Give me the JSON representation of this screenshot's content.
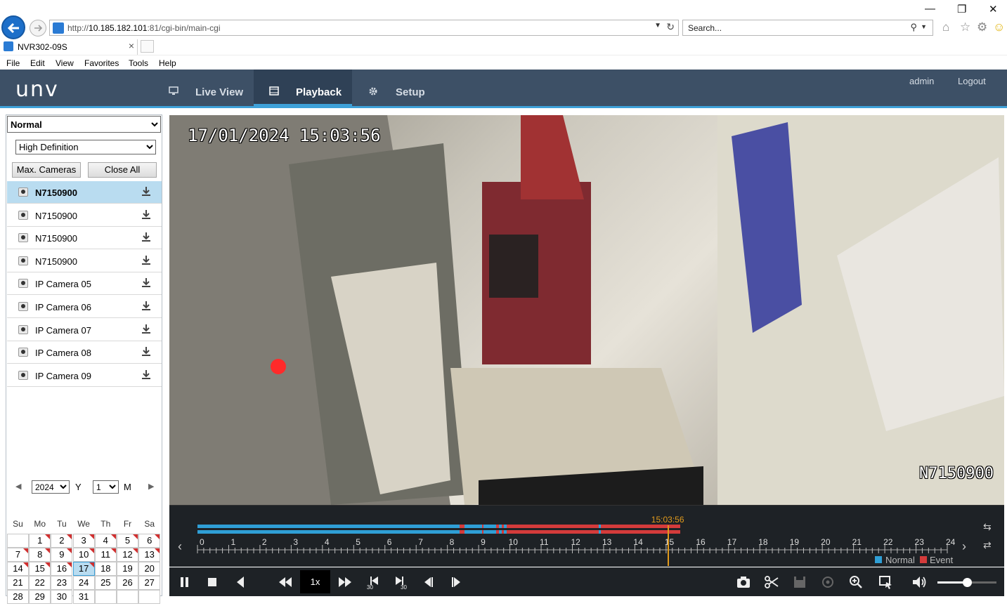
{
  "browser": {
    "url_prefix": "http://",
    "url_host": "10.185.182.101",
    "url_rest": ":81/cgi-bin/main-cgi",
    "search_placeholder": "Search...",
    "tab_title": "NVR302-09S",
    "menu": [
      "File",
      "Edit",
      "View",
      "Favorites",
      "Tools",
      "Help"
    ]
  },
  "app": {
    "logo": "unv",
    "nav": [
      {
        "label": "Live View",
        "icon": "monitor-icon",
        "active": false
      },
      {
        "label": "Playback",
        "icon": "film-icon",
        "active": true
      },
      {
        "label": "Setup",
        "icon": "gear-icon",
        "active": false
      }
    ],
    "user": "admin",
    "logout": "Logout"
  },
  "left": {
    "mode": "Normal",
    "quality": "High Definition",
    "max_cameras": "Max. Cameras",
    "close_all": "Close All",
    "cameras": [
      {
        "name": "N7150900",
        "selected": true
      },
      {
        "name": "N7150900",
        "selected": false
      },
      {
        "name": "N7150900",
        "selected": false
      },
      {
        "name": "N7150900",
        "selected": false
      },
      {
        "name": "IP Camera 05",
        "selected": false
      },
      {
        "name": "IP Camera 06",
        "selected": false
      },
      {
        "name": "IP Camera 07",
        "selected": false
      },
      {
        "name": "IP Camera 08",
        "selected": false
      },
      {
        "name": "IP Camera 09",
        "selected": false
      }
    ]
  },
  "calendar": {
    "year": "2024",
    "year_label": "Y",
    "month": "1",
    "month_label": "M",
    "weekdays": [
      "Su",
      "Mo",
      "Tu",
      "We",
      "Th",
      "Fr",
      "Sa"
    ],
    "first_weekday": 1,
    "days_in_month": 31,
    "marked_days": [
      1,
      2,
      3,
      4,
      5,
      6,
      7,
      8,
      9,
      10,
      11,
      12,
      13,
      14,
      15,
      16,
      17
    ],
    "selected_day": 17
  },
  "video": {
    "timestamp": "17/01/2024 15:03:56",
    "camera_label": "N7150900"
  },
  "timeline": {
    "hours": [
      "0",
      "1",
      "2",
      "3",
      "4",
      "5",
      "6",
      "7",
      "8",
      "9",
      "10",
      "11",
      "12",
      "13",
      "14",
      "15",
      "16",
      "17",
      "18",
      "19",
      "20",
      "21",
      "22",
      "23",
      "24"
    ],
    "current_time": "15:03:56",
    "current_hour": 15.066,
    "normal_color": "#2f9fd6",
    "event_color": "#d43b3b",
    "recordings": [
      {
        "type": "normal",
        "start": 0,
        "end": 8.4
      },
      {
        "type": "event",
        "start": 8.4,
        "end": 8.55
      },
      {
        "type": "normal",
        "start": 8.55,
        "end": 9.1
      },
      {
        "type": "event",
        "start": 9.1,
        "end": 9.15
      },
      {
        "type": "normal",
        "start": 9.15,
        "end": 9.55
      },
      {
        "type": "event",
        "start": 9.55,
        "end": 9.65
      },
      {
        "type": "normal",
        "start": 9.65,
        "end": 9.75
      },
      {
        "type": "event",
        "start": 9.75,
        "end": 9.8
      },
      {
        "type": "normal",
        "start": 9.8,
        "end": 9.9
      },
      {
        "type": "event",
        "start": 9.9,
        "end": 12.85
      },
      {
        "type": "normal",
        "start": 12.85,
        "end": 12.9
      },
      {
        "type": "event",
        "start": 12.9,
        "end": 15.45
      }
    ],
    "legend_normal": "Normal",
    "legend_event": "Event"
  },
  "controls": {
    "speed": "1x",
    "volume": 0.5
  }
}
